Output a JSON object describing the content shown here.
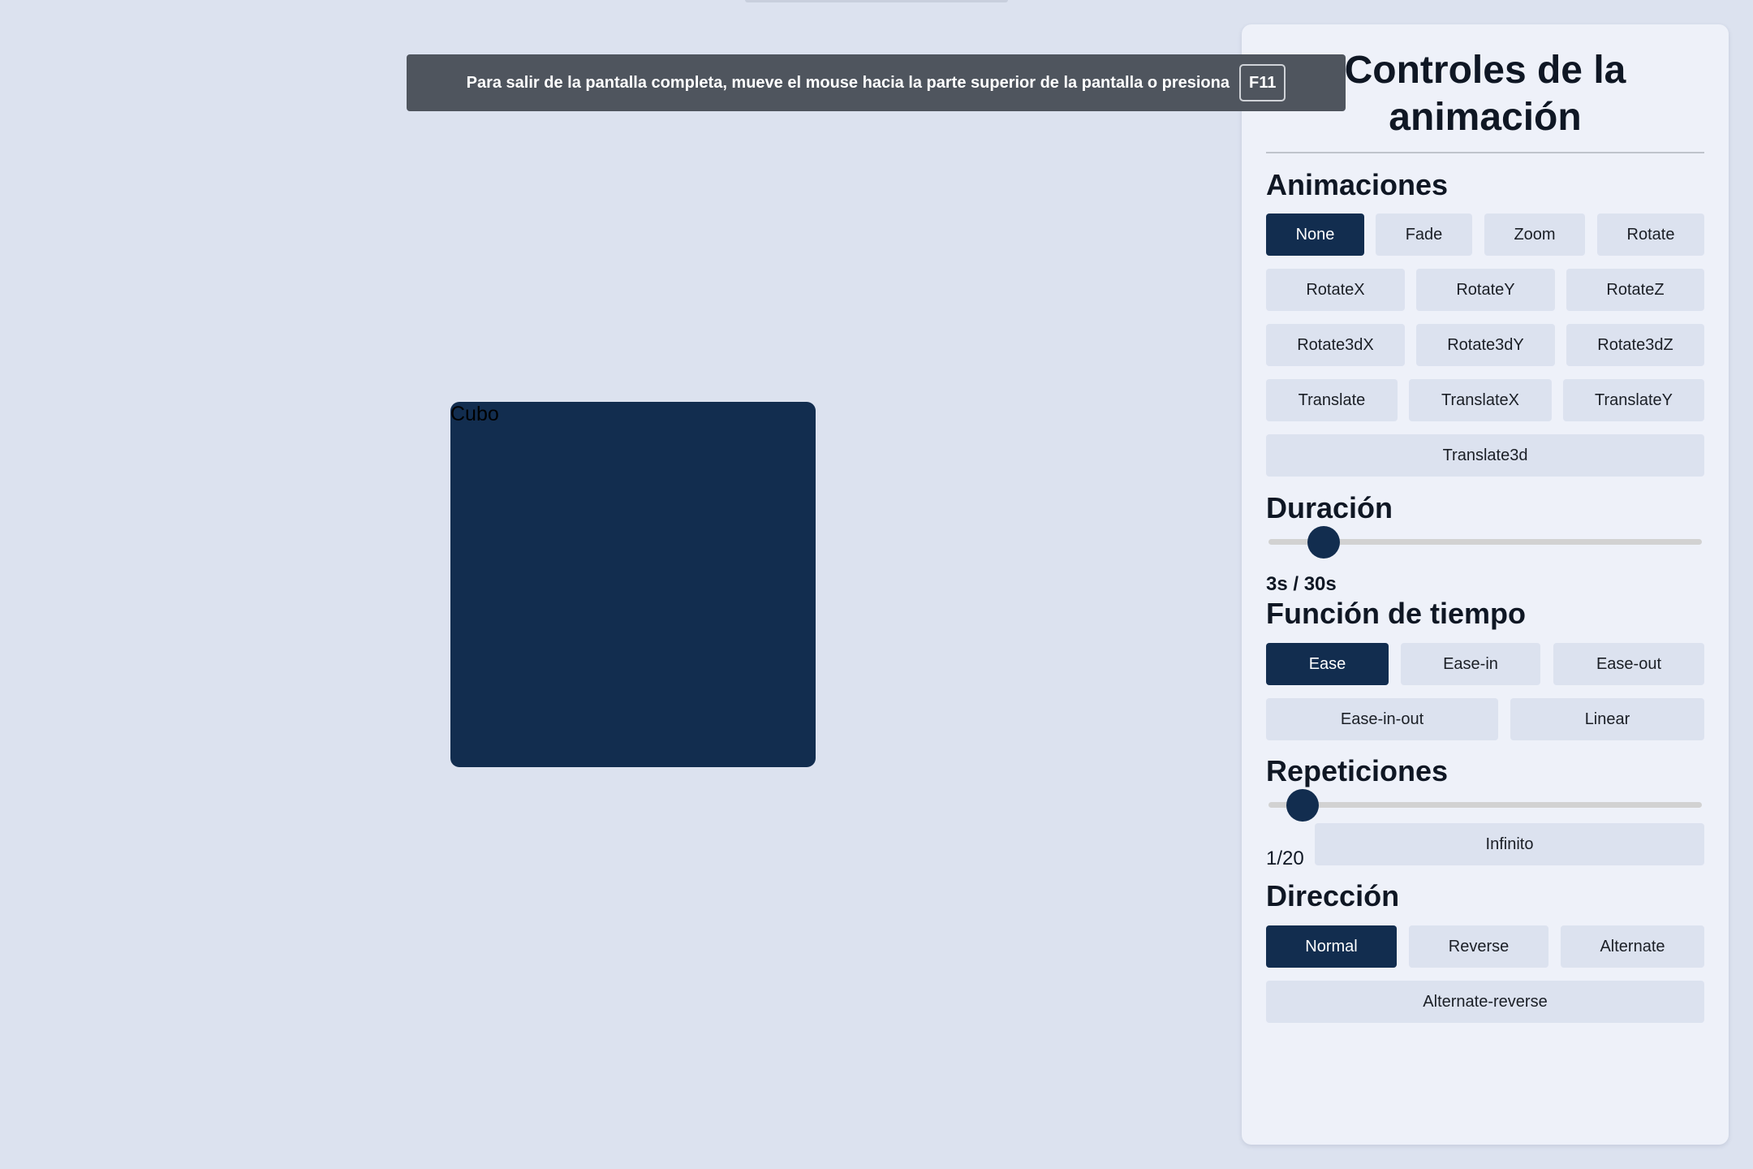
{
  "stage": {
    "cube_label": "Cubo"
  },
  "fullscreen_notice": {
    "message": "Para salir de la pantalla completa, mueve el mouse hacia la parte superior de la pantalla o presiona",
    "key": "F11"
  },
  "panel": {
    "title_line1": "Controles de la",
    "title_line2": "animación",
    "animations": {
      "title": "Animaciones",
      "selected": "None",
      "options": [
        "None",
        "Fade",
        "Zoom",
        "Rotate",
        "RotateX",
        "RotateY",
        "RotateZ",
        "Rotate3dX",
        "Rotate3dY",
        "Rotate3dZ",
        "Translate",
        "TranslateX",
        "TranslateY",
        "Translate3d"
      ]
    },
    "duration": {
      "title": "Duración",
      "value_text": "3s / 30s",
      "value": 3,
      "max": 30
    },
    "timing": {
      "title": "Función de tiempo",
      "selected": "Ease",
      "options": [
        "Ease",
        "Ease-in",
        "Ease-out",
        "Ease-in-out",
        "Linear"
      ]
    },
    "repetitions": {
      "title": "Repeticiones",
      "value_text": "1/20",
      "value": 1,
      "max": 20,
      "infinite_label": "Infinito"
    },
    "direction": {
      "title": "Dirección",
      "selected": "Normal",
      "options": [
        "Normal",
        "Reverse",
        "Alternate",
        "Alternate-reverse"
      ]
    }
  },
  "colors": {
    "background": "#dce2ef",
    "panel": "#eef1f9",
    "accent": "#122d4f",
    "button": "#dce2ef",
    "toast": "#4f555e"
  }
}
